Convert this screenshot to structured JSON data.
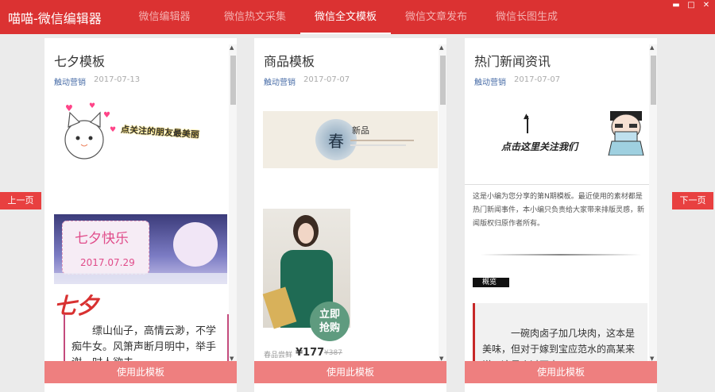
{
  "app": {
    "title": "喵喵-微信编辑器"
  },
  "nav": {
    "tabs": [
      "微信编辑器",
      "微信热文采集",
      "微信全文模板",
      "微信文章发布",
      "微信长图生成"
    ]
  },
  "window": {
    "minimize": "▬",
    "maximize": "□",
    "close": "✕"
  },
  "pager": {
    "prev": "上一页",
    "next": "下一页"
  },
  "use_label": "使用此模板",
  "cards": [
    {
      "title": "七夕模板",
      "author": "触动营销",
      "date": "2017-07-13",
      "banner_text": "点关注的朋友最美丽",
      "festival": "七夕快乐",
      "festival_date": "2017.07.29",
      "big_char": "七夕",
      "poem": "缥山仙子，高情云渺，不学痴牛女。风箫声断月明中，举手谢，时人欲去。"
    },
    {
      "title": "商品模板",
      "author": "触动营销",
      "date": "2017-07-07",
      "banner_char": "春",
      "banner_tag": "新品",
      "buy_badge": "立即抢购",
      "price_label": "春品尝鲜",
      "price": "¥177",
      "old_price": "¥387"
    },
    {
      "title": "热门新闻资讯",
      "author": "触动营销",
      "date": "2017-07-07",
      "follow_text": "点击这里关注我们",
      "intro": "这是小编为您分享的第N期模板。最近使用的素材都是热门新闻事件，本小编只负责给大家带来排版灵感，新闻版权归原作者所有。",
      "section_tag": "概览",
      "quote": "一碗肉卤子加几块肉，这本是美味，但对于嫁到宝应范水的高某来说，这是个过不去"
    }
  ],
  "colors": {
    "brand": "#db3232",
    "button": "#ee7f7f",
    "side": "#e84040"
  }
}
